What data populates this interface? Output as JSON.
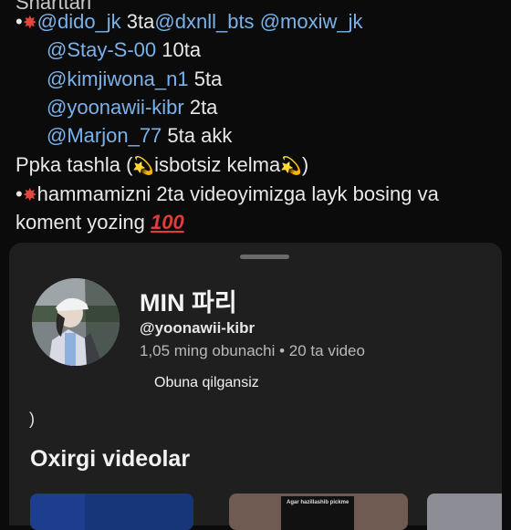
{
  "post": {
    "line0": "Sharttari",
    "line1": {
      "bullet": "•",
      "m1": "@dido_jk",
      "t1": " 3ta",
      "m2": "@dxnll_bts",
      "m3": "@moxiw_jk"
    },
    "line2": {
      "m": "@Stay-S-00",
      "t": " 10ta"
    },
    "line3": {
      "m": "@kimjiwona_n1",
      "t": " 5ta"
    },
    "line4": {
      "m": "@yoonawii-kibr",
      "t": " 2ta"
    },
    "line5": {
      "m": "@Marjon_77",
      "t": " 5ta akk"
    },
    "line6": {
      "a": "Ppka tashla (",
      "b": "isbotsiz kelma",
      "c": ")"
    },
    "line7": {
      "bullet": "•",
      "text": "hammamizni 2ta videoyimizga layk bosing va"
    },
    "line8": {
      "text": "koment yozing",
      "hundred": "100"
    },
    "emoji": {
      "burst": "✸",
      "dizzy": "💫"
    },
    "colors": {
      "mention": "#7ab2ea",
      "burst": "#e0483e",
      "dizzy": "#f2b531",
      "hundred": "#e23b3b"
    }
  },
  "sheet": {
    "channel_name": "MIN 파리",
    "handle": "@yoonawii-kibr",
    "stats": "1,05 ming obunachi • 20 ta video",
    "subscribe_label": "Obuna qilgansiz",
    "paren": ")",
    "section_title": "Oxirgi videolar",
    "thumb2_caption": "Agar hazillashib pickme"
  }
}
